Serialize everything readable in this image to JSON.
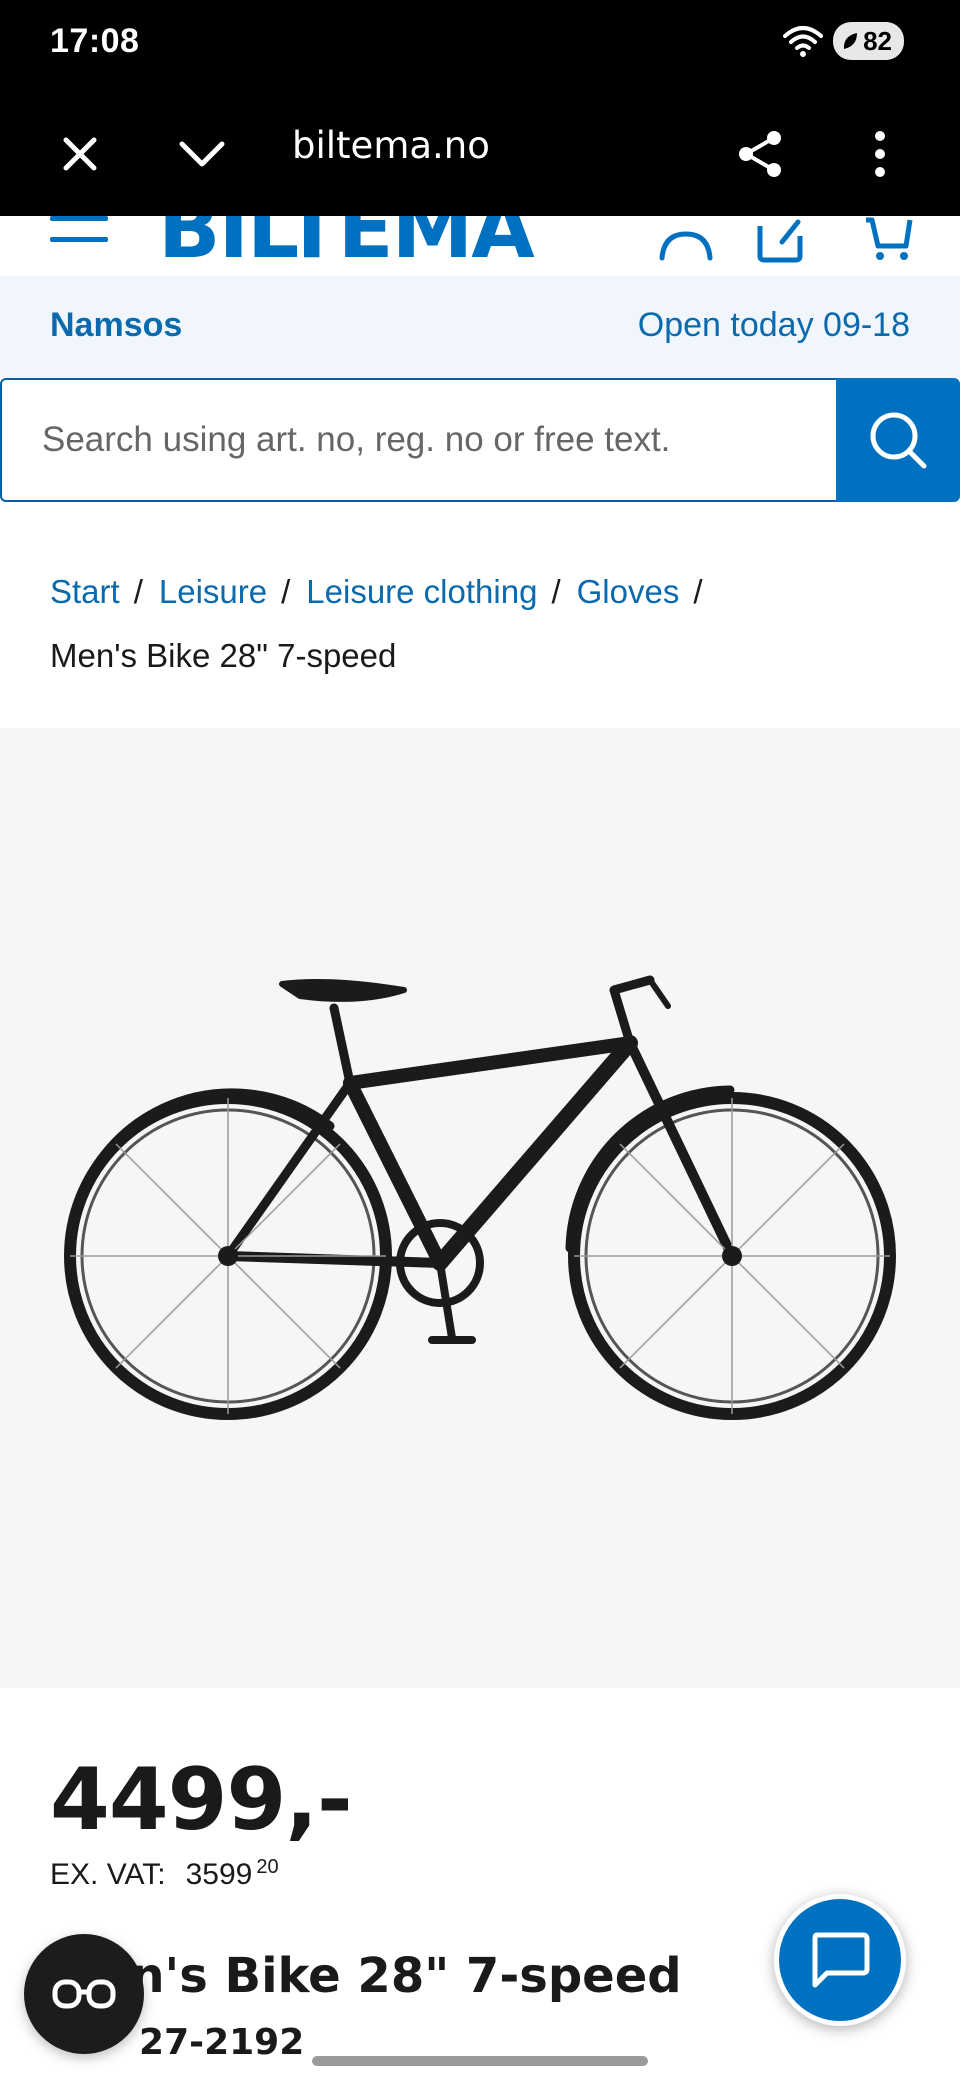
{
  "status": {
    "time": "17:08",
    "battery": "82"
  },
  "browser": {
    "url": "biltema.no"
  },
  "site": {
    "logo": "BILTEMA"
  },
  "store": {
    "name": "Namsos",
    "hours": "Open today 09-18"
  },
  "search": {
    "placeholder": "Search using art. no, reg. no or free text."
  },
  "breadcrumb": {
    "items": [
      "Start",
      "Leisure",
      "Leisure clothing",
      "Gloves"
    ],
    "current": "Men's Bike 28\" 7-speed"
  },
  "product": {
    "price": "4499,-",
    "exvat_label": "EX. VAT:",
    "exvat_value": "3599",
    "exvat_decimals": "20",
    "title_visible": "n's Bike 28\" 7-speed",
    "artno_visible": "27-2192"
  },
  "icons": {
    "close": "close-icon",
    "chevron": "chevron-down-icon",
    "share": "share-icon",
    "more": "more-vertical-icon",
    "search": "search-icon",
    "chat": "chat-icon"
  },
  "colors": {
    "brand": "#0070c0",
    "link": "#0a6aad",
    "storebar_bg": "#f0f6fb"
  }
}
